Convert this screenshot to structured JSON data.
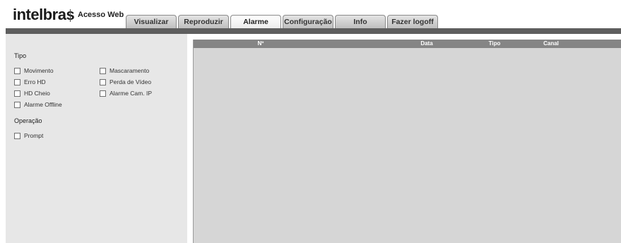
{
  "header": {
    "logo": "intelbras",
    "product_name": "Acesso Web",
    "tabs": [
      {
        "label": "Visualizar",
        "active": false
      },
      {
        "label": "Reproduzir",
        "active": false
      },
      {
        "label": "Alarme",
        "active": true
      },
      {
        "label": "Configuração",
        "active": false
      },
      {
        "label": "Info",
        "active": false
      },
      {
        "label": "Fazer logoff",
        "active": false
      }
    ]
  },
  "left_panel": {
    "tipo_title": "Tipo",
    "tipo_items": [
      {
        "label": "Movimento",
        "checked": false
      },
      {
        "label": "Mascaramento",
        "checked": false
      },
      {
        "label": "Erro HD",
        "checked": false
      },
      {
        "label": "Perda de Vídeo",
        "checked": false
      },
      {
        "label": "HD Cheio",
        "checked": false
      },
      {
        "label": "Alarme Cam. IP",
        "checked": false
      },
      {
        "label": "Alarme Offline",
        "checked": false
      }
    ],
    "operacao_title": "Operação",
    "operacao_items": [
      {
        "label": "Prompt",
        "checked": false
      }
    ]
  },
  "table": {
    "columns": [
      "Nº",
      "Data",
      "Tipo",
      "Canal"
    ],
    "rows": []
  },
  "colors": {
    "header_bar": "#5e5e5e",
    "panel_bg": "#e7e7e7",
    "table_header_bg": "#858585",
    "table_body_bg": "#d6d6d6"
  }
}
